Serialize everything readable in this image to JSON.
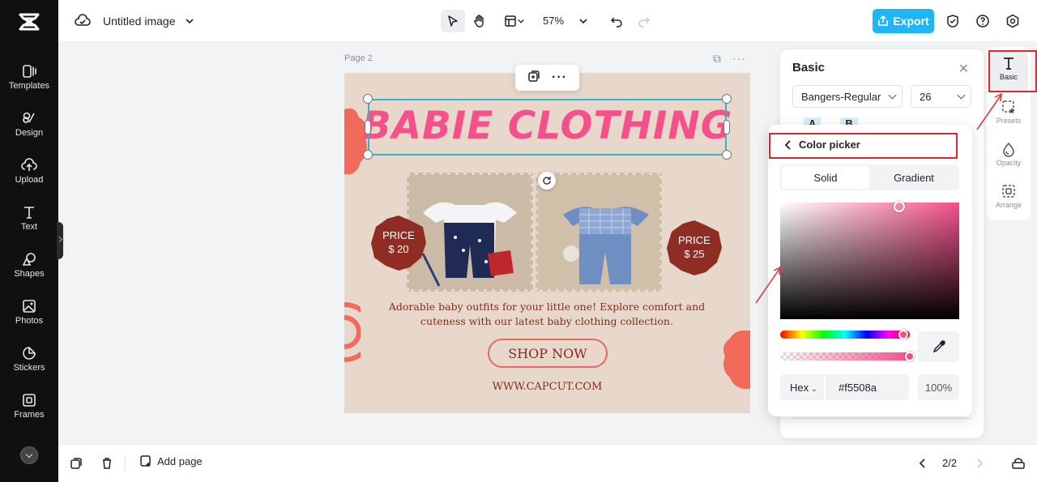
{
  "app": {
    "document_title": "Untitled image"
  },
  "sidebar": {
    "items": [
      {
        "label": "Templates",
        "icon": "templates-icon"
      },
      {
        "label": "Design",
        "icon": "design-icon"
      },
      {
        "label": "Upload",
        "icon": "upload-icon"
      },
      {
        "label": "Text",
        "icon": "text-icon"
      },
      {
        "label": "Shapes",
        "icon": "shapes-icon"
      },
      {
        "label": "Photos",
        "icon": "photos-icon"
      },
      {
        "label": "Stickers",
        "icon": "stickers-icon"
      },
      {
        "label": "Frames",
        "icon": "frames-icon"
      }
    ]
  },
  "toolbar": {
    "zoom": "57%",
    "export_label": "Export"
  },
  "canvas": {
    "page_label": "Page 2",
    "design": {
      "title": "BABIE CLOTHING",
      "price_left_label": "PRICE",
      "price_left_value": "$ 20",
      "price_right_label": "PRICE",
      "price_right_value": "$ 25",
      "description": "Adorable baby outfits for your little one! Explore comfort and cuteness with our latest baby clothing collection.",
      "button": "SHOP NOW",
      "url": "WWW.CAPCUT.COM"
    }
  },
  "right_tools": {
    "items": [
      {
        "label": "Basic",
        "icon": "text-basic-icon"
      },
      {
        "label": "Presets",
        "icon": "presets-icon"
      },
      {
        "label": "Opacity",
        "icon": "opacity-icon"
      },
      {
        "label": "Arrange",
        "icon": "arrange-icon"
      }
    ]
  },
  "basic_panel": {
    "title": "Basic",
    "font": "Bangers-Regular",
    "size": "26"
  },
  "color_picker": {
    "title": "Color picker",
    "tabs": [
      "Solid",
      "Gradient"
    ],
    "mode": "Hex",
    "hex": "#f5508a",
    "opacity": "100%"
  },
  "bottom": {
    "add_page": "Add page",
    "page_count": "2/2"
  },
  "colors": {
    "accent": "#1fb6f5",
    "title_pink": "#f5508a",
    "coral": "#e7695a",
    "brown": "#7e2d1e",
    "highlight": "#e8242c"
  }
}
